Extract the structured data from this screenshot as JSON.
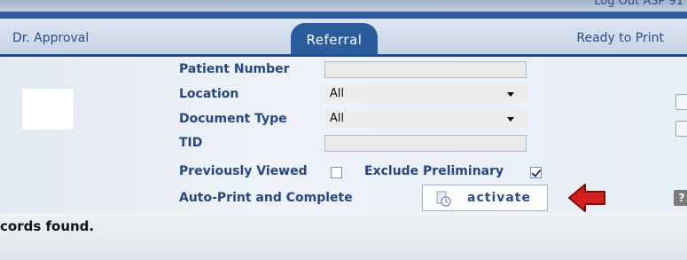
{
  "header": {
    "logout_text": "Log Out ASP 91"
  },
  "tabs": [
    {
      "label": "Dr. Approval",
      "active": false
    },
    {
      "label": "Referral",
      "active": true
    },
    {
      "label": "Ready to Print",
      "active": false
    }
  ],
  "form": {
    "patient_number": {
      "label": "Patient Number",
      "value": ""
    },
    "location": {
      "label": "Location",
      "value": "All"
    },
    "document_type": {
      "label": "Document Type",
      "value": "All"
    },
    "tid": {
      "label": "TID",
      "value": ""
    },
    "previously_viewed": {
      "label": "Previously Viewed",
      "checked": false
    },
    "exclude_preliminary": {
      "label": "Exclude Preliminary",
      "checked": true
    },
    "auto_print": {
      "label": "Auto-Print and Complete",
      "button_label": "activate"
    }
  },
  "status": {
    "text": "cords found."
  },
  "colors": {
    "accent": "#2b5d9e",
    "label": "#28477e",
    "arrow": "#d21f1f"
  },
  "icons": [
    "activate-icon",
    "red-arrow-icon",
    "help-icon"
  ]
}
